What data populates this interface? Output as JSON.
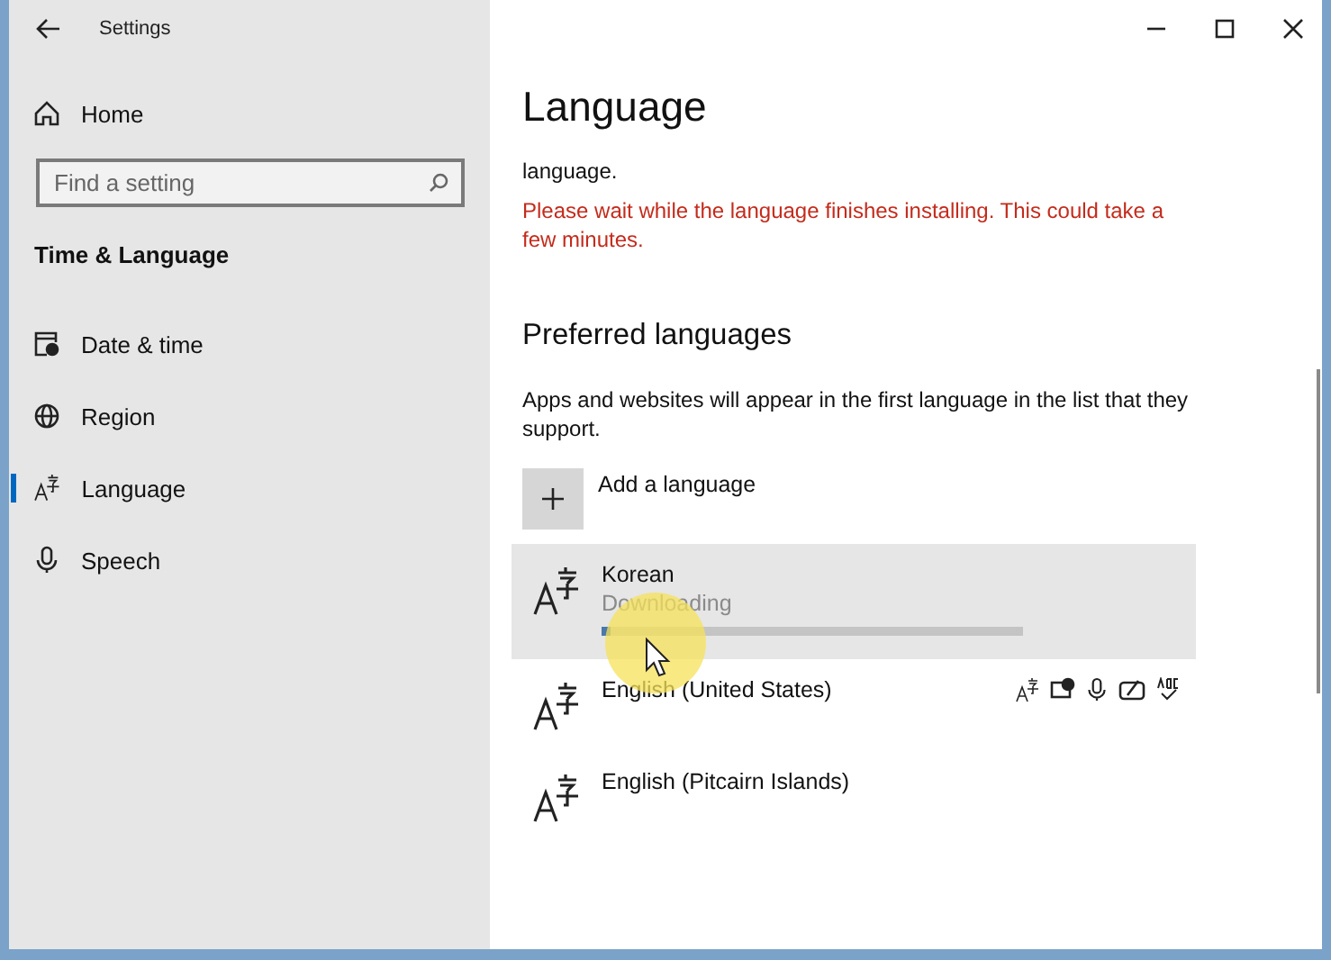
{
  "window": {
    "title": "Settings"
  },
  "sidebar": {
    "home": "Home",
    "search": {
      "placeholder": "Find a setting"
    },
    "section": "Time & Language",
    "items": [
      {
        "label": "Date & time",
        "kind": "clock",
        "selected": false
      },
      {
        "label": "Region",
        "kind": "globe",
        "selected": false
      },
      {
        "label": "Language",
        "kind": "language",
        "selected": true
      },
      {
        "label": "Speech",
        "kind": "mic",
        "selected": false
      }
    ]
  },
  "content": {
    "title": "Language",
    "intro": "language.",
    "warning": "Please wait while the language finishes installing. This could take a few minutes.",
    "section": "Preferred languages",
    "description": "Apps and websites will appear in the first language in the list that they support.",
    "add_button": "Add a language",
    "languages": [
      {
        "name": "Korean",
        "status": "Downloading",
        "level": 0.02,
        "selected": true,
        "features": false
      },
      {
        "name": "English (United States)",
        "selected": false,
        "features": true
      },
      {
        "name": "English (Pitcairn Islands)",
        "selected": false,
        "features": false
      }
    ]
  }
}
